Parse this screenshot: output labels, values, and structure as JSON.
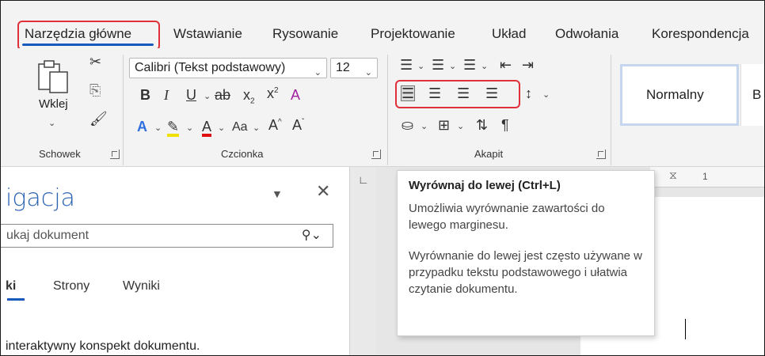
{
  "tabs": {
    "items": [
      "Narzędzia główne",
      "Wstawianie",
      "Rysowanie",
      "Projektowanie",
      "Układ",
      "Odwołania",
      "Korespondencja"
    ],
    "active": "Narzędzia główne"
  },
  "ribbon": {
    "clipboard": {
      "paste_label": "Wklej",
      "group_label": "Schowek"
    },
    "font": {
      "font_name": "Calibri (Tekst podstawowy)",
      "font_size": "12",
      "change_case": "Aa",
      "group_label": "Czcionka"
    },
    "paragraph": {
      "group_label": "Akapit"
    },
    "styles": {
      "normal": "Normalny",
      "next_partial": "B"
    }
  },
  "tooltip": {
    "title": "Wyrównaj do lewej (Ctrl+L)",
    "line1": "Umożliwia wyrównanie zawartości do lewego marginesu.",
    "line2": "Wyrównanie do lewej jest często używane w przypadku tekstu podstawowego i ułatwia czytanie dokumentu."
  },
  "nav_pane": {
    "title": "igacja",
    "search_placeholder": "ukaj dokument",
    "tabs": [
      "ki",
      "Strony",
      "Wyniki"
    ],
    "body_text": "interaktywny konspekt dokumentu."
  },
  "ruler": {
    "marker": "1"
  },
  "colors": {
    "accent": "#185abd",
    "highlight": "#e0303a"
  }
}
